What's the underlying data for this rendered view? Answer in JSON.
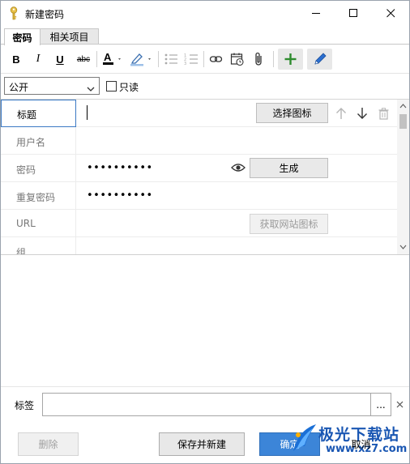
{
  "window": {
    "title": "新建密码",
    "icon": "key-icon"
  },
  "tabs": [
    {
      "label": "密码",
      "active": true
    },
    {
      "label": "相关项目",
      "active": false
    }
  ],
  "toolbar": {
    "bold": "B",
    "italic": "I",
    "underline": "U",
    "strikethrough": "abc",
    "font_color_glyph": "A",
    "font_color": "#000000",
    "add_accent": "#2e8b2e",
    "pen_accent": "#2b6fd0"
  },
  "access": {
    "visibility_value": "公开",
    "readonly_label": "只读",
    "readonly_checked": false
  },
  "fields": {
    "title_label": "标题",
    "title_value": "",
    "choose_icon_button": "选择图标",
    "username_label": "用户名",
    "username_value": "",
    "password_label": "密码",
    "password_value": "••••••••••",
    "generate_button": "生成",
    "repeat_label": "重复密码",
    "repeat_value": "••••••••••",
    "url_label": "URL",
    "url_value": "",
    "fetch_icon_button": "获取网站图标",
    "group_label": "组"
  },
  "tags": {
    "label": "标签",
    "value": "",
    "more_button": "..."
  },
  "footer": {
    "delete_button": "删除",
    "save_new_button": "保存并新建",
    "ok_button": "确定",
    "cancel_button": "取消"
  },
  "watermark": {
    "brand": "极光下载站",
    "url": "www.xz7.com"
  },
  "colors": {
    "primary": "#3c85d8",
    "focus_border": "#3b79c4",
    "watermark": "#1a57b3"
  }
}
